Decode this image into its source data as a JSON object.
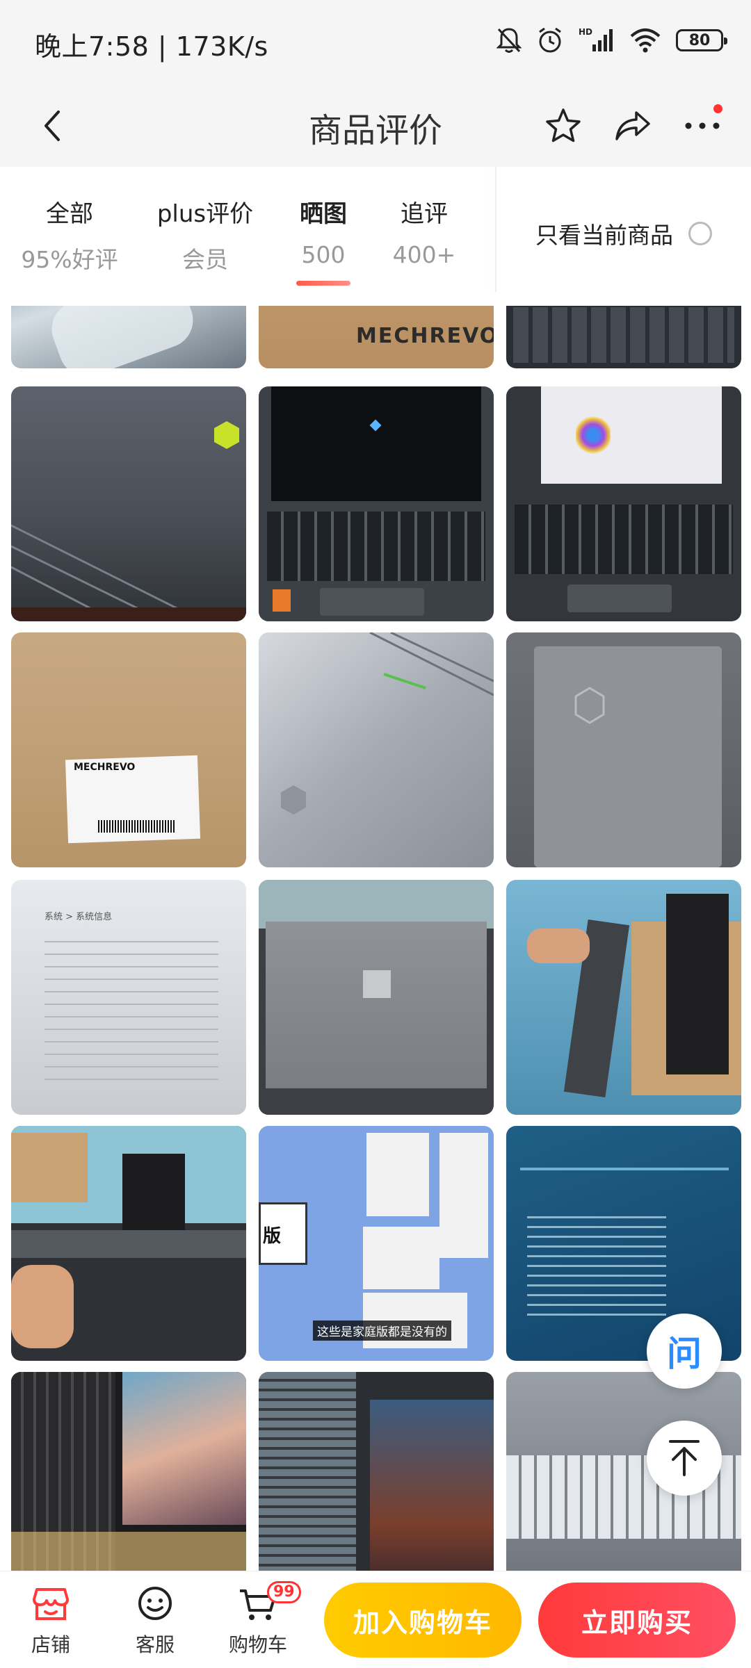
{
  "status_bar": {
    "time_speed": "晚上7:58 | 173K/s",
    "battery": "80"
  },
  "nav": {
    "title": "商品评价",
    "icons": [
      "back-icon",
      "star-icon",
      "share-icon",
      "more-icon"
    ]
  },
  "tabs": [
    {
      "label": "全部",
      "sub": "95%好评"
    },
    {
      "label": "plus评价",
      "sub": "会员"
    },
    {
      "label": "晒图",
      "sub": "500",
      "active": true
    },
    {
      "label": "追评",
      "sub": "400+"
    }
  ],
  "filter": {
    "label": "只看当前商品"
  },
  "photos": {
    "brand_text": "MECHREVO",
    "system_info_title": "系统 > 系统信息",
    "video_caption": "这些是家庭版都是没有的",
    "partial_text": "版"
  },
  "floating": {
    "ask_label": "问"
  },
  "bottom_bar": {
    "store_label": "店铺",
    "service_label": "客服",
    "cart_label": "购物车",
    "cart_badge": "99",
    "add_to_cart": "加入购物车",
    "buy_now": "立即购买"
  },
  "colors": {
    "accent_red": "#ff3a3a",
    "accent_yellow": "#ffc400",
    "ask_blue": "#2a8cff"
  }
}
